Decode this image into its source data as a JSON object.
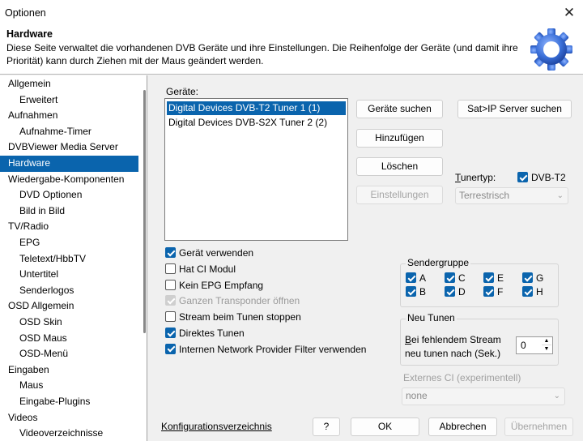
{
  "window": {
    "title": "Optionen",
    "close_glyph": "✕"
  },
  "header": {
    "title": "Hardware",
    "description": "Diese Seite verwaltet die vorhandenen DVB Geräte und ihre Einstellungen. Die Reihenfolge der Geräte (und damit ihre Priorität) kann durch Ziehen mit der Maus geändert werden.",
    "icon": "gear-icon",
    "icon_color": "#3a6fd8"
  },
  "sidebar": {
    "selected_color": "#0a64ad",
    "items": [
      {
        "label": "Allgemein",
        "level": 0
      },
      {
        "label": "Erweitert",
        "level": 1
      },
      {
        "label": "Aufnahmen",
        "level": 0
      },
      {
        "label": "Aufnahme-Timer",
        "level": 1
      },
      {
        "label": "DVBViewer Media Server",
        "level": 0
      },
      {
        "label": "Hardware",
        "level": 0,
        "selected": true
      },
      {
        "label": "Wiedergabe-Komponenten",
        "level": 0
      },
      {
        "label": "DVD Optionen",
        "level": 1
      },
      {
        "label": "Bild in Bild",
        "level": 1
      },
      {
        "label": "TV/Radio",
        "level": 0
      },
      {
        "label": "EPG",
        "level": 1
      },
      {
        "label": "Teletext/HbbTV",
        "level": 1
      },
      {
        "label": "Untertitel",
        "level": 1
      },
      {
        "label": "Senderlogos",
        "level": 1
      },
      {
        "label": "OSD Allgemein",
        "level": 0
      },
      {
        "label": "OSD Skin",
        "level": 1
      },
      {
        "label": "OSD Maus",
        "level": 1
      },
      {
        "label": "OSD-Menü",
        "level": 1
      },
      {
        "label": "Eingaben",
        "level": 0
      },
      {
        "label": "Maus",
        "level": 1
      },
      {
        "label": "Eingabe-Plugins",
        "level": 1
      },
      {
        "label": "Videos",
        "level": 0
      },
      {
        "label": "Videoverzeichnisse",
        "level": 1
      }
    ]
  },
  "devices": {
    "label": "Geräte:",
    "items": [
      {
        "label": "Digital Devices DVB-T2 Tuner 1 (1)",
        "selected": true
      },
      {
        "label": "Digital Devices DVB-S2X Tuner 2 (2)",
        "selected": false
      }
    ]
  },
  "buttons": {
    "search_devices": "Geräte suchen",
    "satip_search": "Sat>IP Server suchen",
    "add": "Hinzufügen",
    "delete": "Löschen",
    "settings": "Einstellungen"
  },
  "tuner": {
    "label_prefix": "T",
    "label_rest": "unertyp:",
    "dvb_t2_label": "DVB-T2",
    "dvb_t2_checked": true,
    "type_value": "Terrestrisch"
  },
  "options": [
    {
      "label": "Gerät verwenden",
      "checked": true,
      "disabled": false
    },
    {
      "label": "Hat CI Modul",
      "checked": false,
      "disabled": false
    },
    {
      "label": "Kein EPG Empfang",
      "checked": false,
      "disabled": false
    },
    {
      "label": "Ganzen Transponder öffnen",
      "checked": true,
      "disabled": true
    },
    {
      "label": "Stream beim Tunen stoppen",
      "checked": false,
      "disabled": false
    },
    {
      "label": "Direktes Tunen",
      "checked": true,
      "disabled": false
    },
    {
      "label": "Internen Network Provider Filter verwenden",
      "checked": true,
      "disabled": false
    }
  ],
  "sendergruppe": {
    "title": "Sendergruppe",
    "items": [
      {
        "label": "A",
        "checked": true
      },
      {
        "label": "C",
        "checked": true
      },
      {
        "label": "E",
        "checked": true
      },
      {
        "label": "G",
        "checked": true
      },
      {
        "label": "B",
        "checked": true
      },
      {
        "label": "D",
        "checked": true
      },
      {
        "label": "F",
        "checked": true
      },
      {
        "label": "H",
        "checked": true
      }
    ]
  },
  "neu_tunen": {
    "title": "Neu Tunen",
    "label_line1_prefix": "B",
    "label_line1_rest": "ei fehlendem Stream",
    "label_line2": "neu tunen nach (Sek.)",
    "value": "0"
  },
  "externes_ci": {
    "label": "Externes CI (experimentell)",
    "value": "none"
  },
  "footer": {
    "config_link": "Konfigurationsverzeichnis",
    "help": "?",
    "ok": "OK",
    "cancel": "Abbrechen",
    "apply": "Übernehmen"
  }
}
